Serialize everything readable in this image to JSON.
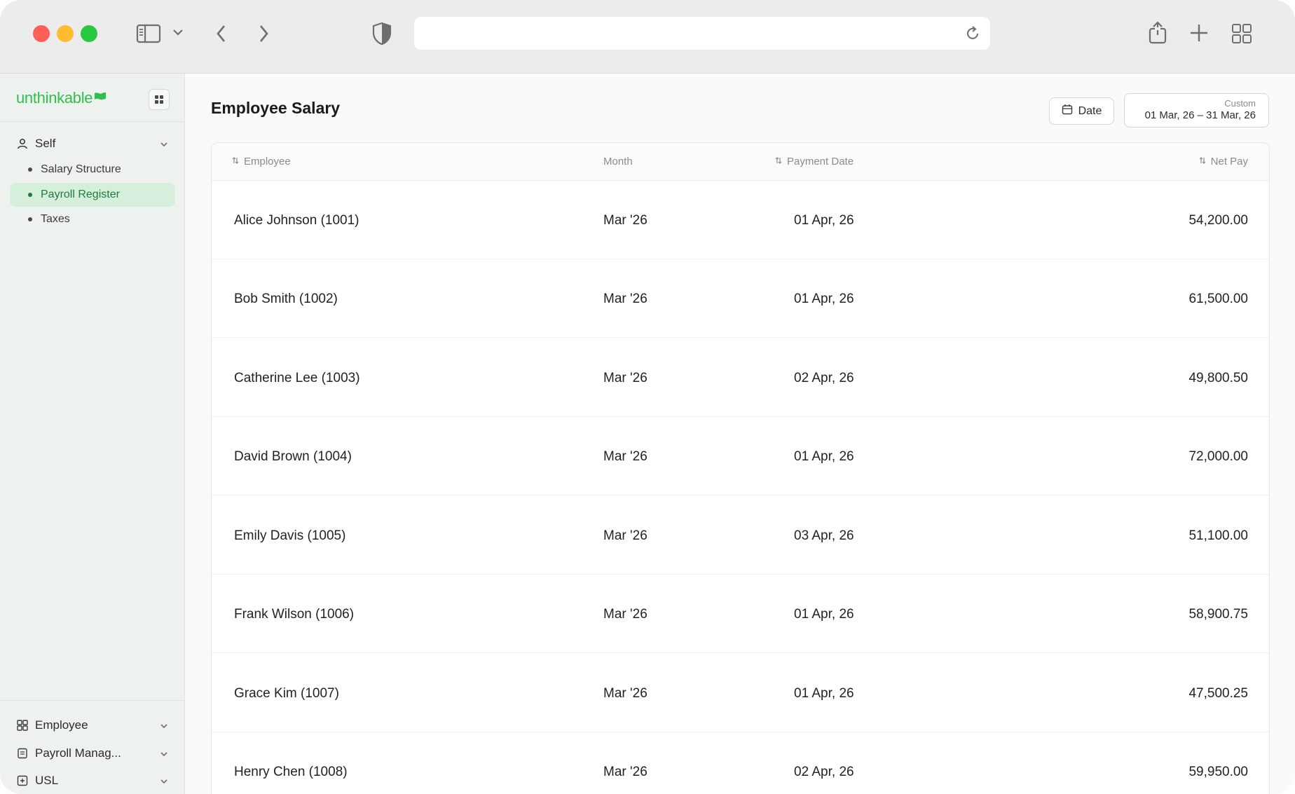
{
  "app": {
    "logo_text": "unthinkable",
    "page_title": "Employee Salary"
  },
  "sidebar": {
    "group_self": "Self",
    "items": [
      {
        "label": "Salary Structure",
        "active": false
      },
      {
        "label": "Payroll Register",
        "active": true
      },
      {
        "label": "Taxes",
        "active": false
      }
    ],
    "bottom_groups": [
      {
        "label": "Employee",
        "icon": "grid-icon"
      },
      {
        "label": "Payroll Manag...",
        "icon": "document-icon"
      },
      {
        "label": "USL",
        "icon": "plus-square-icon"
      }
    ]
  },
  "filters": {
    "date_button": "Date",
    "range_label": "Custom",
    "range_value": "01 Mar, 26 – 31 Mar, 26"
  },
  "table": {
    "columns": [
      "Employee",
      "Month",
      "Payment Date",
      "Net Pay"
    ],
    "rows": [
      {
        "employee": "Alice Johnson (1001)",
        "month": "Mar '26",
        "payment_date": "01 Apr, 26",
        "net_pay": "54,200.00"
      },
      {
        "employee": "Bob Smith (1002)",
        "month": "Mar '26",
        "payment_date": "01 Apr, 26",
        "net_pay": "61,500.00"
      },
      {
        "employee": "Catherine Lee (1003)",
        "month": "Mar '26",
        "payment_date": "02 Apr, 26",
        "net_pay": "49,800.50"
      },
      {
        "employee": "David Brown (1004)",
        "month": "Mar '26",
        "payment_date": "01 Apr, 26",
        "net_pay": "72,000.00"
      },
      {
        "employee": "Emily Davis (1005)",
        "month": "Mar '26",
        "payment_date": "03 Apr, 26",
        "net_pay": "51,100.00"
      },
      {
        "employee": "Frank Wilson (1006)",
        "month": "Mar '26",
        "payment_date": "01 Apr, 26",
        "net_pay": "58,900.75"
      },
      {
        "employee": "Grace Kim (1007)",
        "month": "Mar '26",
        "payment_date": "01 Apr, 26",
        "net_pay": "47,500.25"
      },
      {
        "employee": "Henry Chen (1008)",
        "month": "Mar '26",
        "payment_date": "02 Apr, 26",
        "net_pay": "59,950.00"
      }
    ]
  },
  "colors": {
    "brand_green": "#2fbf4d",
    "active_bg": "#d6efdc",
    "sidebar_bg": "#eef2ef"
  }
}
